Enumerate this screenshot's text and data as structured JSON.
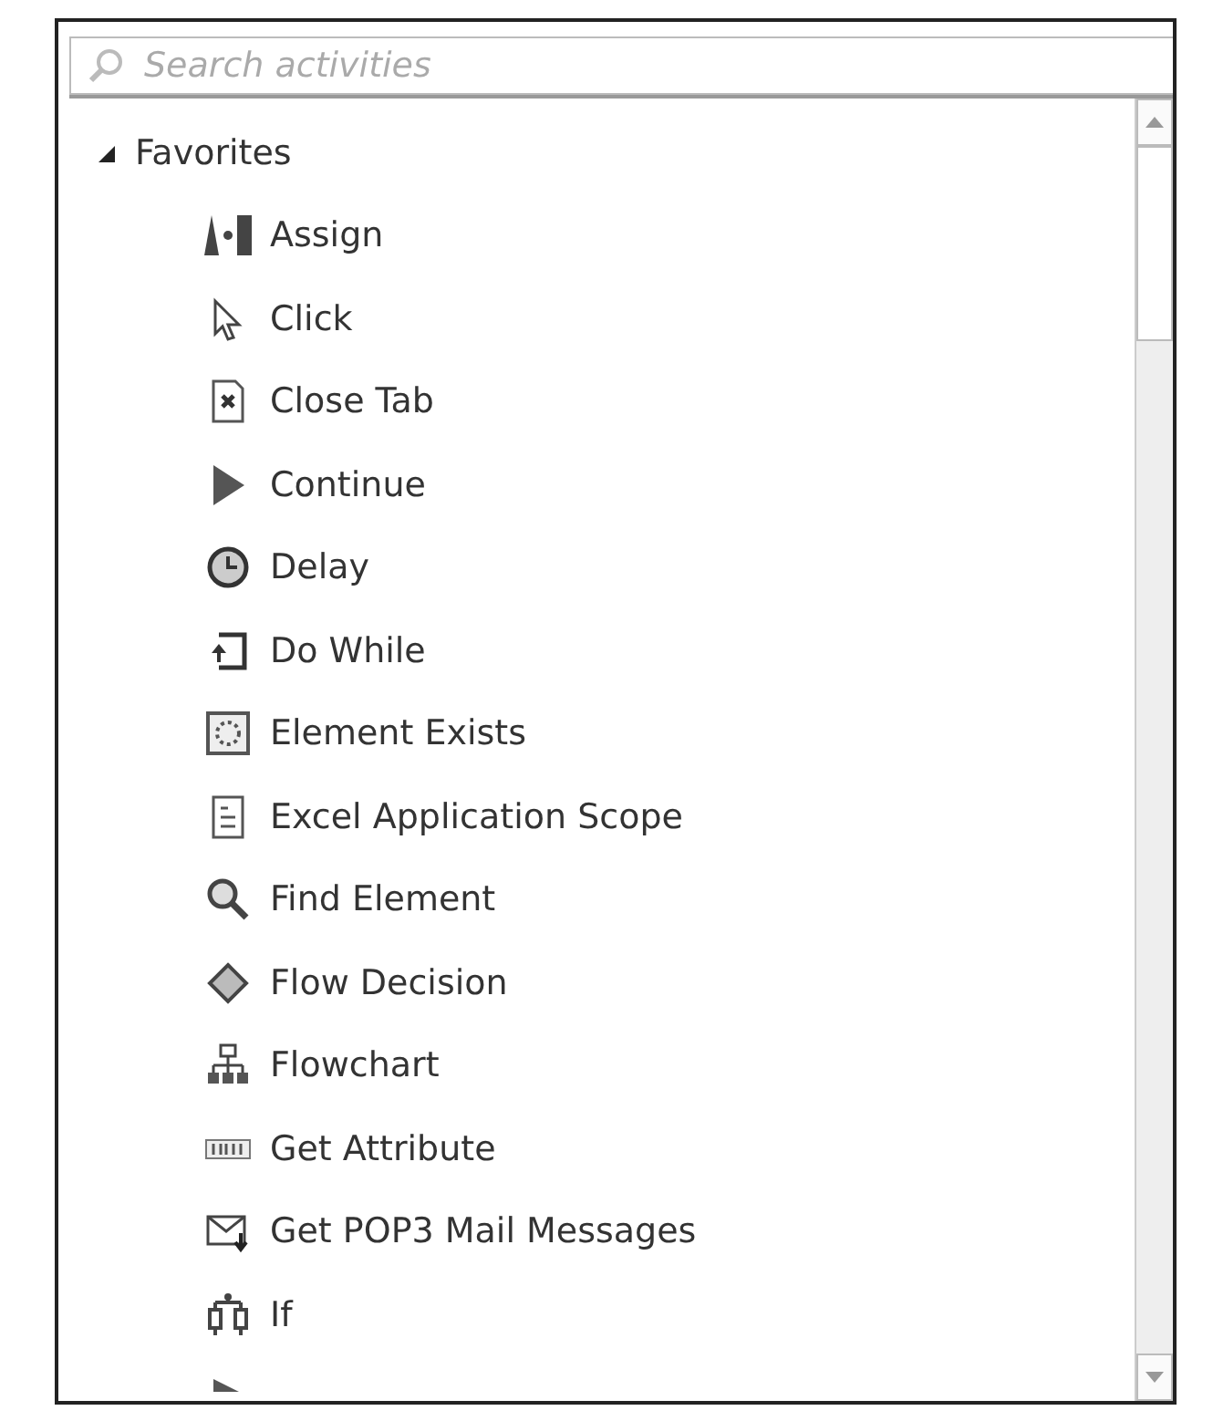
{
  "search": {
    "placeholder": "Search activities"
  },
  "tree": [
    {
      "label": "Favorites",
      "expanded": true,
      "children": [
        {
          "label": "Assign"
        },
        {
          "label": "Click"
        },
        {
          "label": "Close Tab"
        },
        {
          "label": "Continue"
        },
        {
          "label": "Delay"
        },
        {
          "label": "Do While"
        },
        {
          "label": "Element Exists"
        },
        {
          "label": "Excel Application Scope"
        },
        {
          "label": "Find Element"
        },
        {
          "label": "Flow Decision"
        },
        {
          "label": "Flowchart"
        },
        {
          "label": "Get Attribute"
        },
        {
          "label": "Get POP3 Mail Messages"
        },
        {
          "label": "If"
        }
      ]
    }
  ]
}
